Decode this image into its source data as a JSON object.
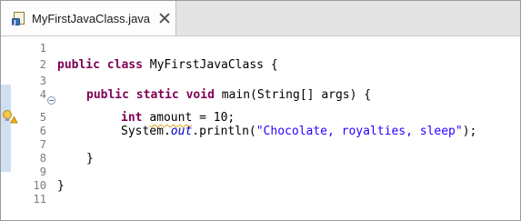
{
  "tab": {
    "filename": "MyFirstJavaClass.java",
    "icon": "java-file-icon",
    "close_icon": "close-icon"
  },
  "gutter": {
    "line_numbers": [
      "1",
      "2",
      "3",
      "4",
      "5",
      "6",
      "7",
      "8",
      "9",
      "10",
      "11"
    ],
    "fold_icon": "collapse-minus-icon",
    "warning_icon": "warning-lightbulb-icon"
  },
  "code": {
    "l2_kw1": "public",
    "l2_kw2": "class",
    "l2_rest": " MyFirstJavaClass {",
    "l4_kw1": "public",
    "l4_kw2": "static",
    "l4_kw3": "void",
    "l4_rest1": " main(String[] ",
    "l4_param": "args",
    "l4_rest2": ") {",
    "l5_kw": "int",
    "l5_var": "amount",
    "l5_rest": " = 10;",
    "l6_pre": "System.",
    "l6_field": "out",
    "l6_mid": ".println(",
    "l6_str": "\"Chocolate, royalties, sleep\"",
    "l6_end": ");",
    "l8_brace": "}",
    "l10_brace": "}"
  },
  "colors": {
    "keyword": "#7f0055",
    "string": "#2a00ff",
    "field": "#0000c0",
    "ruler_highlight": "#cfe0f1",
    "warning": "#e0a21a"
  }
}
